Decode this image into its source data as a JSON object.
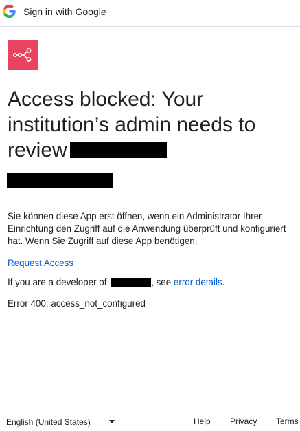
{
  "header": {
    "title": "Sign in with Google",
    "logo_icon": "google-g-icon"
  },
  "app": {
    "icon": "share-nodes-icon",
    "icon_bg": "#e8445f"
  },
  "main": {
    "title": "Access blocked: Your institution’s admin needs to review",
    "description": "Sie können diese App erst öffnen, wenn ein Administrator Ihrer Einrichtung den Zugriff auf die Anwendung überprüft und konfiguriert hat. Wenn Sie Zugriff auf diese App benötigen,",
    "request_access": "Request Access",
    "developer_prefix": "If you are a developer of",
    "developer_middle": ", see",
    "error_details": "error details",
    "developer_suffix": ".",
    "error_code": "Error 400: access_not_configured"
  },
  "footer": {
    "language": "English (United States)",
    "help": "Help",
    "privacy": "Privacy",
    "terms": "Terms"
  },
  "colors": {
    "link": "#0b57d0",
    "text": "#202124",
    "divider": "#dadce0"
  }
}
